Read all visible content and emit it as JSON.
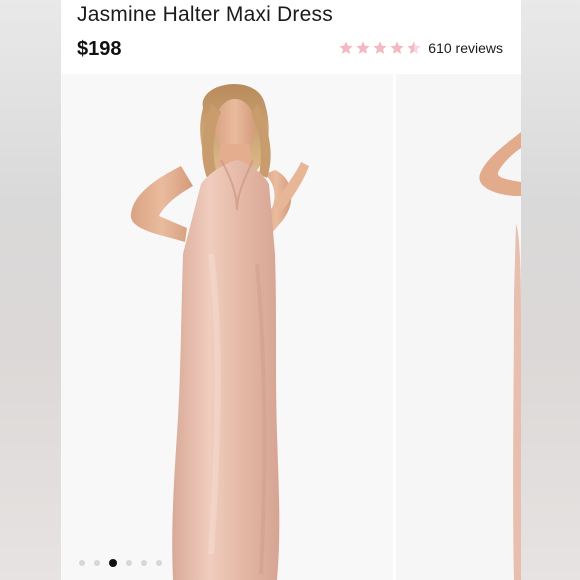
{
  "product": {
    "title": "Jasmine Halter Maxi Dress",
    "price": "$198",
    "rating": 4.5,
    "review_count": "610 reviews",
    "star_color": "#f3b8c2",
    "star_empty_color": "#f5d7dc"
  },
  "gallery": {
    "slide_count": 6,
    "active_index": 2,
    "dress_color": "#e8bfae"
  }
}
